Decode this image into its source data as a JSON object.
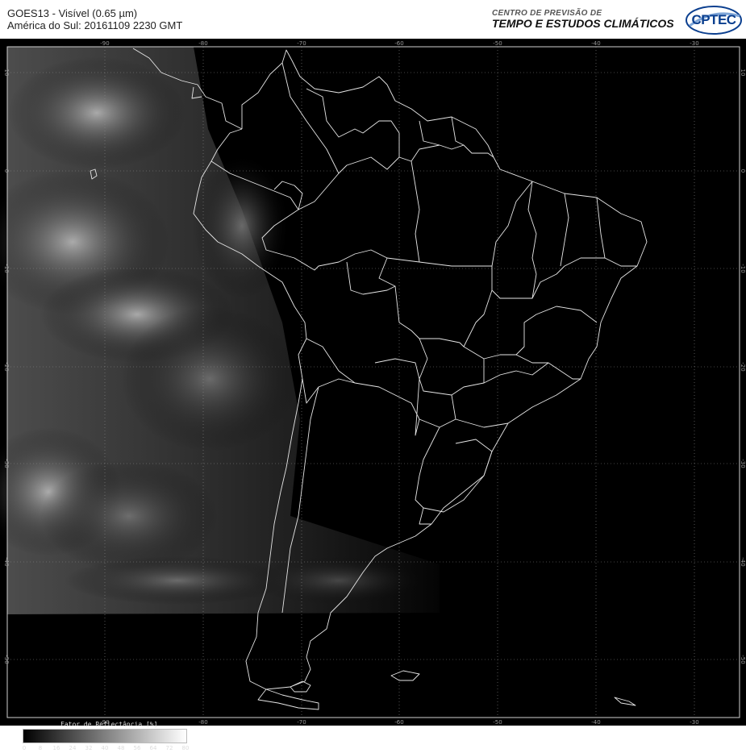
{
  "header": {
    "title_line1": "GOES13 - Visível (0.65 µm)",
    "title_line2": "América do Sul: 20161109 2230 GMT",
    "org_line1": "CENTRO DE PREVISÃO DE",
    "org_line2": "TEMPO E ESTUDOS CLIMÁTICOS",
    "logo_text": "CPTEC",
    "logo_color": "#0b3f8f"
  },
  "map": {
    "longitude_labels": [
      "-90",
      "-80",
      "-70",
      "-60",
      "-50",
      "-40",
      "-30"
    ],
    "latitude_labels": [
      "10",
      "0",
      "-10",
      "-20",
      "-30",
      "-40",
      "-50"
    ],
    "background_color": "#000000",
    "grid_color": "#8a8a8a",
    "outline_color": "#e6e6e6"
  },
  "colorbar": {
    "title": "Fator de Reflectância [%]",
    "labels": [
      "0",
      "8",
      "16",
      "24",
      "32",
      "40",
      "48",
      "56",
      "64",
      "72",
      "80"
    ]
  }
}
